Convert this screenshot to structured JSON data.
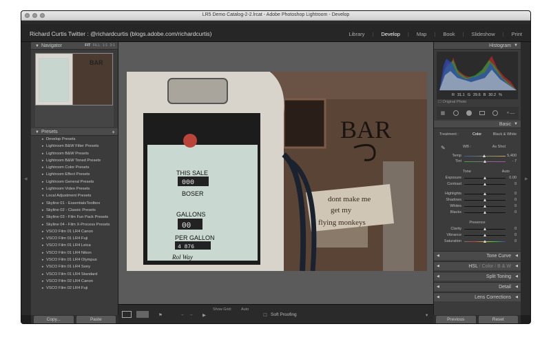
{
  "window": {
    "title": "LR5 Demo Catalog-2-2.lrcat - Adobe Photoshop Lightroom - Develop"
  },
  "identity_plate": "Richard Curtis Twitter : @richardcurtis (blogs.adobe.com/richardcurtis)",
  "modules": [
    {
      "label": "Library",
      "active": false
    },
    {
      "label": "Develop",
      "active": true
    },
    {
      "label": "Map",
      "active": false
    },
    {
      "label": "Book",
      "active": false
    },
    {
      "label": "Slideshow",
      "active": false
    },
    {
      "label": "Print",
      "active": false
    }
  ],
  "navigator": {
    "title": "Navigator",
    "zoom_options": [
      "FIT",
      "FILL",
      "1:1",
      "3:1"
    ],
    "thumb_text": "BAR"
  },
  "presets": {
    "title": "Presets",
    "add_symbol": "+",
    "items": [
      "Develop Presets",
      "Lightroom B&W Filter Presets",
      "Lightroom B&W Presets",
      "Lightroom B&W Toned Presets",
      "Lightroom Color Presets",
      "Lightroom Effect Presets",
      "Lightroom General Presets",
      "Lightroom Video Presets",
      "Local Adjustment Presets",
      "Skyline 01 - EssentialsToolbox",
      "Skyline 02 - Classic Presets",
      "Skyline 03 - Film Fun Pack Presets",
      "Skyline 04 - Film X-Process Presets",
      "VSCO Film 01 LR4 Canon",
      "VSCO Film 01 LR4 Fuji",
      "VSCO Film 01 LR4 Leica",
      "VSCO Film 01 LR4 Nikon",
      "VSCO Film 01 LR4 Olympus",
      "VSCO Film 01 LR4 Sony",
      "VSCO Film 01 LR4 Standard",
      "VSCO Film 02 LR4 Canon",
      "VSCO Film 02 LR4 Fuji"
    ]
  },
  "left_buttons": {
    "copy": "Copy...",
    "paste": "Paste"
  },
  "photo": {
    "pump_texts": [
      "THIS SALE",
      "BOSER",
      "GALLONS",
      "PER GALLON",
      "Rol Way"
    ],
    "pump_digits": [
      "000",
      "00",
      "4 876"
    ],
    "sign_text": "BAR",
    "board_lines": [
      "dont make me",
      "get my",
      "flying monkeys"
    ]
  },
  "toolbar": {
    "show_grid_label": "Show Grid:",
    "show_grid_value": "Auto",
    "soft_proofing": "Soft Proofing"
  },
  "histogram": {
    "title": "Histogram",
    "r_label": "R",
    "r_value": "31.1",
    "g_label": "G",
    "g_value": "29.6",
    "b_label": "B",
    "b_value": "30.2",
    "unit": "%",
    "original_photo": "Original Photo"
  },
  "basic": {
    "title": "Basic",
    "treatment_label": "Treatment :",
    "treatment_color": "Color",
    "treatment_bw": "Black & White",
    "wb_label": "WB :",
    "wb_value": "As Shot",
    "temp_label": "Temp",
    "temp_value": "5,400",
    "tint_label": "Tint",
    "tint_value": "- 7",
    "tone_label": "Tone",
    "tone_auto": "Auto",
    "exposure_label": "Exposure",
    "exposure_value": "0.00",
    "contrast_label": "Contrast",
    "contrast_value": "0",
    "highlights_label": "Highlights",
    "highlights_value": "0",
    "shadows_label": "Shadows",
    "shadows_value": "0",
    "whites_label": "Whites",
    "whites_value": "0",
    "blacks_label": "Blacks",
    "blacks_value": "0",
    "presence_label": "Presence",
    "clarity_label": "Clarity",
    "clarity_value": "0",
    "vibrance_label": "Vibrance",
    "vibrance_value": "0",
    "saturation_label": "Saturation",
    "saturation_value": "0"
  },
  "collapsed_panels": {
    "tone_curve": "Tone Curve",
    "hsl": "HSL",
    "hsl_sep1": "/",
    "hsl_color": "Color",
    "hsl_sep2": "/",
    "hsl_bw": "B & W",
    "split_toning": "Split Toning",
    "detail": "Detail",
    "lens_corrections": "Lens Corrections"
  },
  "right_buttons": {
    "previous": "Previous",
    "reset": "Reset"
  }
}
